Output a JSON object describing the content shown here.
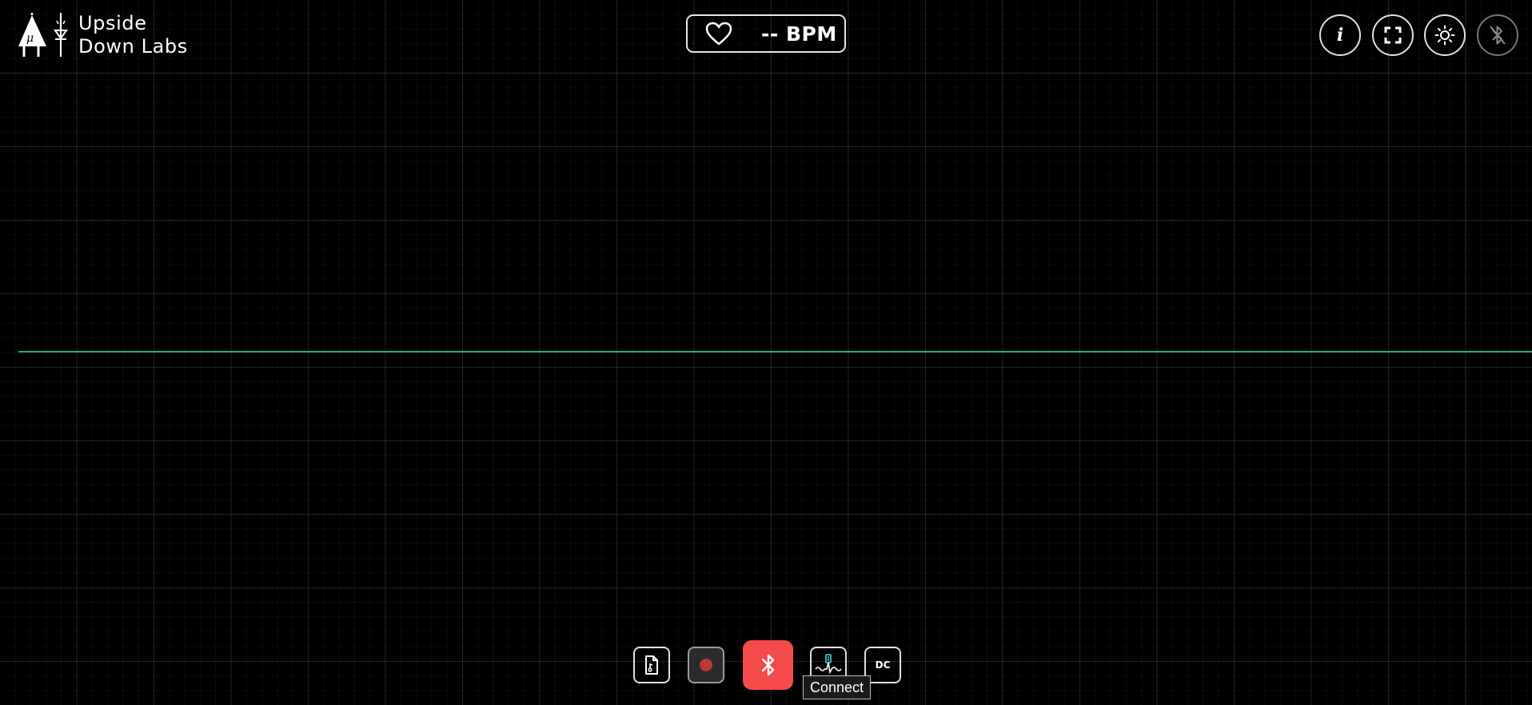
{
  "brand": {
    "line1": "Upside",
    "line2": "Down Labs"
  },
  "heart_rate": {
    "value_text": "-- BPM",
    "icon": "heart-icon"
  },
  "top_controls": [
    {
      "name": "info-button",
      "icon": "info-icon",
      "glyph": "i"
    },
    {
      "name": "fullscreen-button",
      "icon": "fullscreen-icon"
    },
    {
      "name": "theme-button",
      "icon": "sun-icon"
    },
    {
      "name": "bluetooth-status-button",
      "icon": "bluetooth-off-icon",
      "disabled": true
    }
  ],
  "bottom_toolbar": [
    {
      "name": "file-button",
      "icon": "file-icon"
    },
    {
      "name": "record-button",
      "icon": "record-dot-icon"
    },
    {
      "name": "connect-button",
      "icon": "bluetooth-icon"
    },
    {
      "name": "ecg-filter-button",
      "icon": "ecg-wave-icon"
    },
    {
      "name": "dc-button",
      "label": "DC"
    }
  ],
  "tooltip": {
    "text": "Connect"
  },
  "colors": {
    "background": "#000000",
    "signal": "#1fae79",
    "connect_button": "#f54a4a",
    "record_dot": "#b83a3a"
  }
}
